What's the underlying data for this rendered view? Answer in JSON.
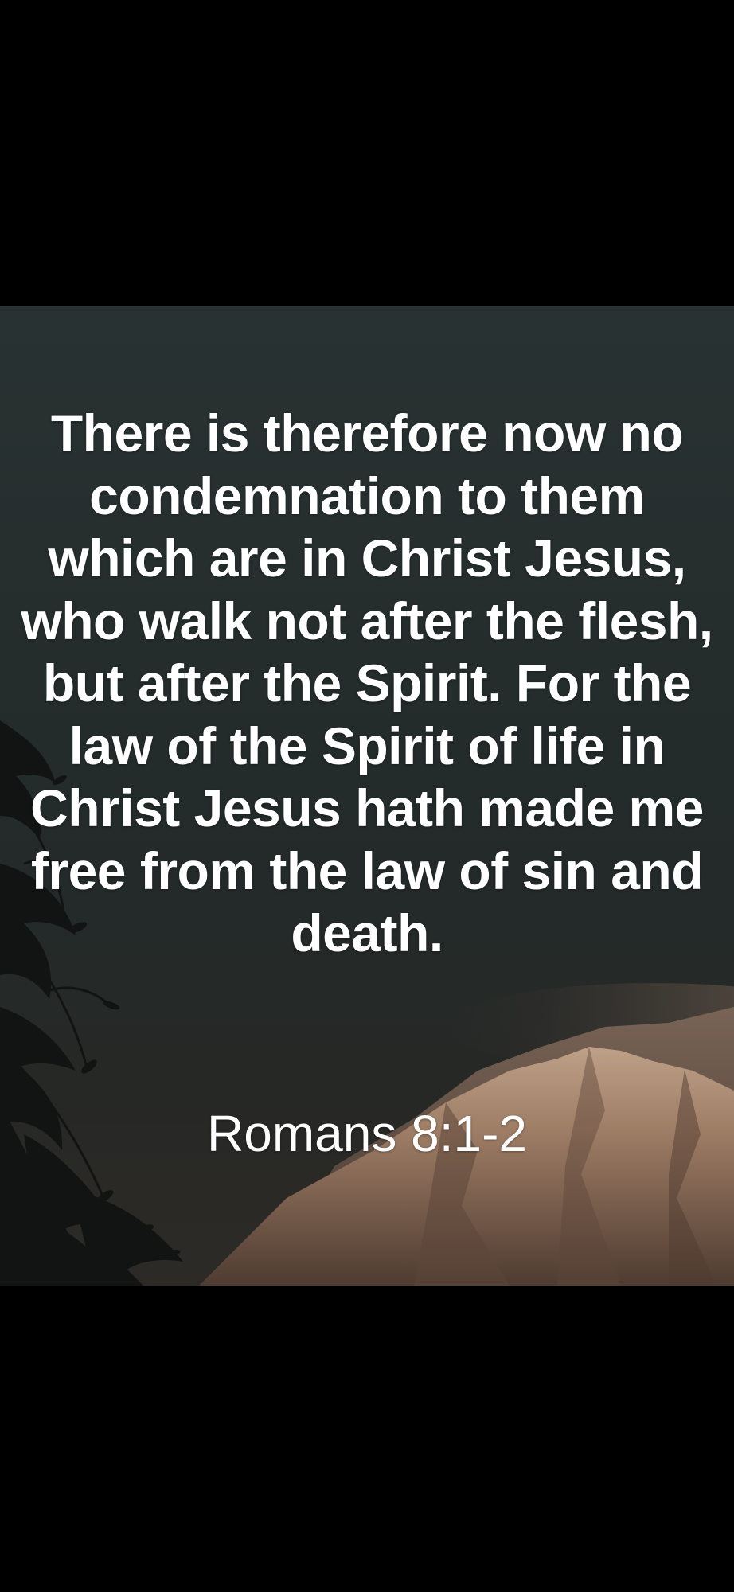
{
  "verse": {
    "text": "There is therefore now no condemnation to them which are in Christ Jesus, who walk not after the flesh, but after the Spirit. For the law of the Spirit of life in Christ Jesus hath made me free from the law of sin and death.",
    "reference": "Romans 8:1-2"
  },
  "background": {
    "subject": "dusky sky over a sunlit mountain ridge with silhouetted tree branches",
    "sky_color": "#2b3434",
    "mountain_light_color": "#c8a488",
    "mountain_shadow_color": "#4a3a32",
    "foliage_color": "#141716",
    "letterbox_color": "#000000"
  }
}
